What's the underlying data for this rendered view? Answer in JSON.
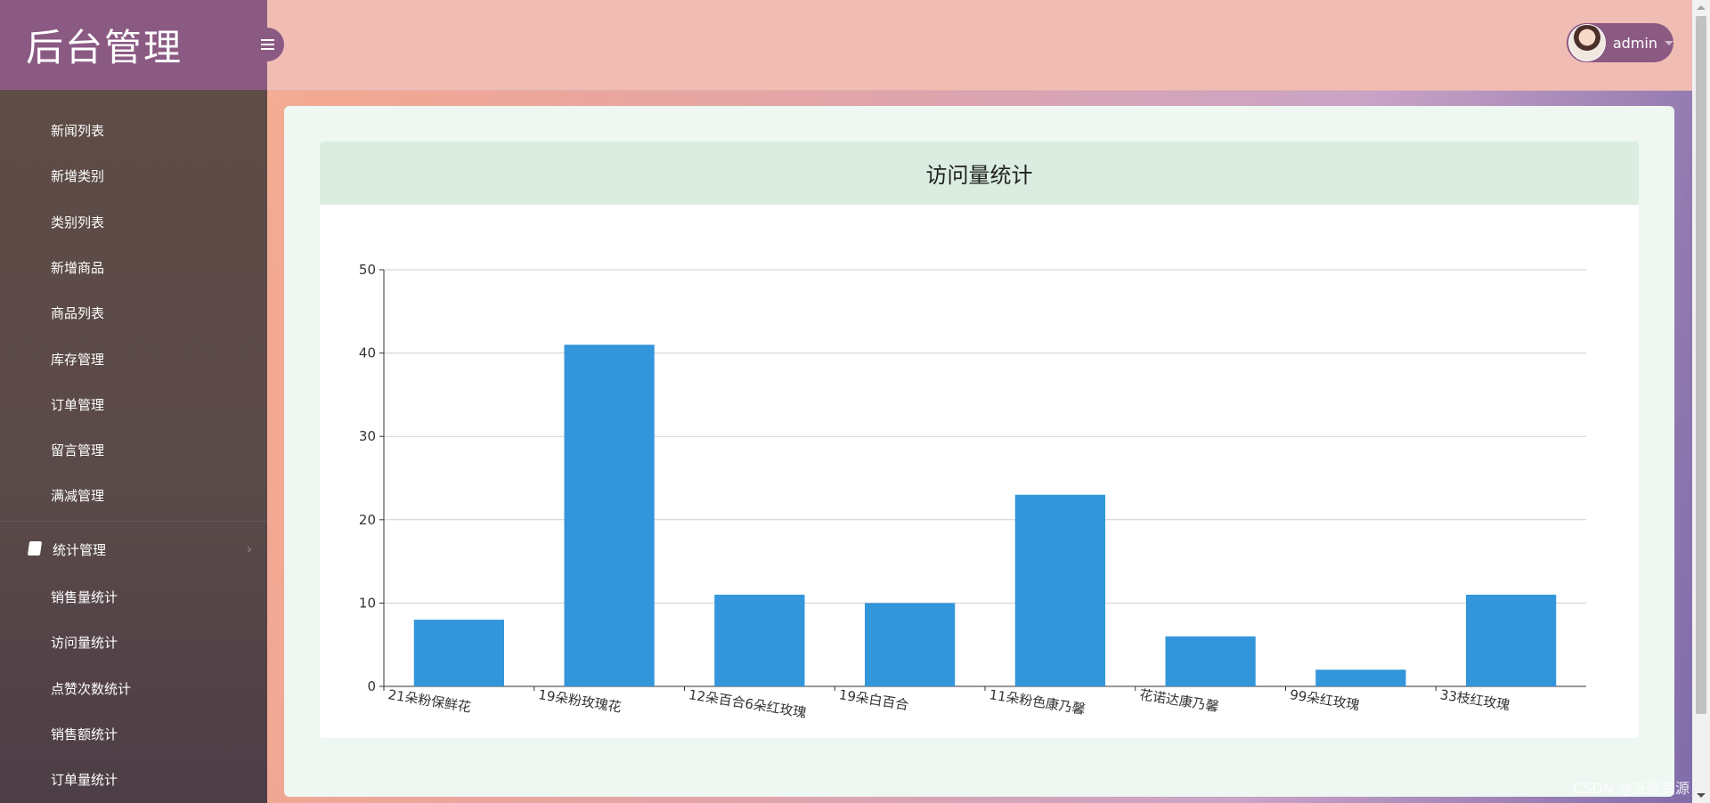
{
  "brand": {
    "title": "后台管理"
  },
  "sidebar": {
    "items": [
      {
        "label": "新闻列表"
      },
      {
        "label": "新增类别"
      },
      {
        "label": "类别列表"
      },
      {
        "label": "新增商品"
      },
      {
        "label": "商品列表"
      },
      {
        "label": "库存管理"
      },
      {
        "label": "订单管理"
      },
      {
        "label": "留言管理"
      },
      {
        "label": "满减管理"
      }
    ],
    "group": {
      "label": "统计管理",
      "chevron": "›"
    },
    "subitems": [
      {
        "label": "销售量统计"
      },
      {
        "label": "访问量统计"
      },
      {
        "label": "点赞次数统计"
      },
      {
        "label": "销售额统计"
      },
      {
        "label": "订单量统计"
      }
    ]
  },
  "topbar": {
    "user": {
      "name": "admin"
    }
  },
  "chart_data": {
    "type": "bar",
    "title": "访问量统计",
    "categories": [
      "21朵粉保鲜花",
      "19朵粉玫瑰花",
      "12朵百合6朵红玫瑰",
      "19朵白百合",
      "11朵粉色康乃馨",
      "花诺达康乃馨",
      "99朵红玫瑰",
      "33枝红玫瑰"
    ],
    "values": [
      8,
      41,
      11,
      10,
      23,
      6,
      2,
      11
    ],
    "ylim": [
      0,
      50
    ],
    "yticks": [
      0,
      10,
      20,
      30,
      40,
      50
    ],
    "color": "#3396db",
    "grid": true
  },
  "watermark": "CSDN @五星资源",
  "colors": {
    "brand": "#8b5a83",
    "bar": "#3396db",
    "topbar": "#f0bcb4"
  }
}
